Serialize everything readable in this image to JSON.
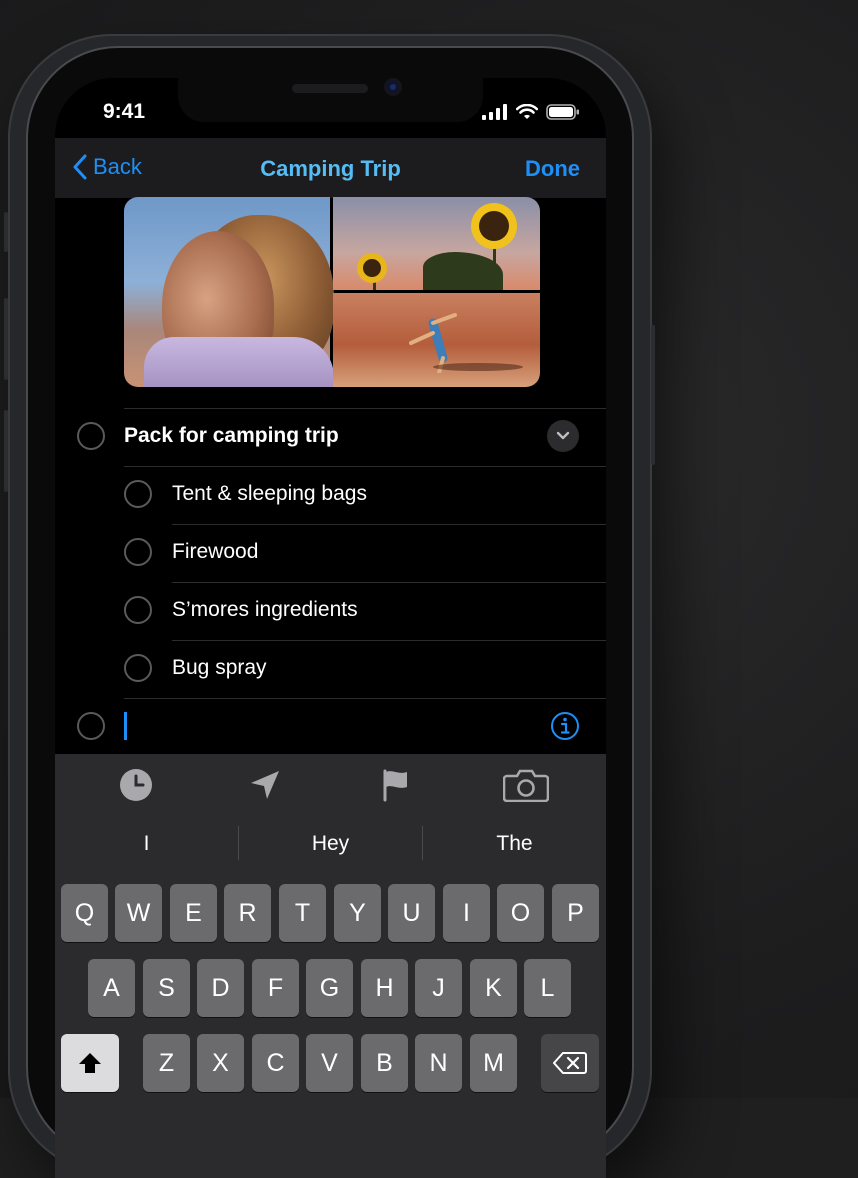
{
  "status": {
    "time": "9:41"
  },
  "nav": {
    "back_label": "Back",
    "title": "Camping Trip",
    "done_label": "Done"
  },
  "list": {
    "parent": {
      "label": "Pack for camping trip"
    },
    "subtasks": [
      {
        "label": "Tent & sleeping bags"
      },
      {
        "label": "Firewood"
      },
      {
        "label": "S’mores ingredients"
      },
      {
        "label": "Bug spray"
      }
    ],
    "new_item": {
      "value": ""
    }
  },
  "toolbar": {
    "icons": [
      "clock-icon",
      "location-arrow-icon",
      "flag-icon",
      "camera-icon"
    ]
  },
  "keyboard": {
    "suggestions": [
      "I",
      "Hey",
      "The"
    ],
    "rows": [
      [
        "Q",
        "W",
        "E",
        "R",
        "T",
        "Y",
        "U",
        "I",
        "O",
        "P"
      ],
      [
        "A",
        "S",
        "D",
        "F",
        "G",
        "H",
        "J",
        "K",
        "L"
      ],
      [
        "Z",
        "X",
        "C",
        "V",
        "B",
        "N",
        "M"
      ]
    ]
  },
  "colors": {
    "accent_blue": "#1d8ff7",
    "title_blue": "#55bdf5",
    "screen_bg": "#000000",
    "keyboard_bg": "#2b2b2d",
    "key_bg": "#6b6b6e"
  }
}
